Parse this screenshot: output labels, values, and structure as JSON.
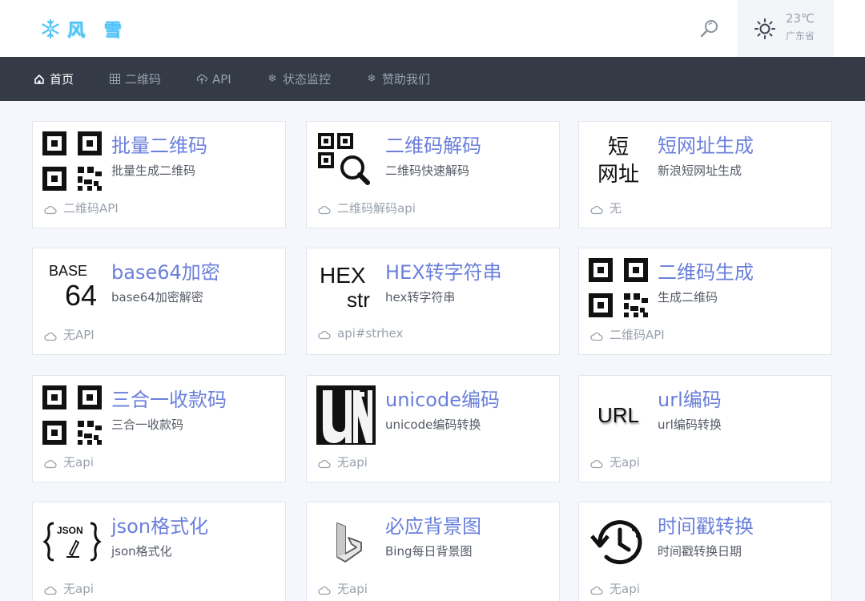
{
  "header": {
    "logo_text": "风 雪",
    "weather": {
      "temp": "23℃",
      "city": "广东省"
    }
  },
  "nav": {
    "items": [
      {
        "label": "首页",
        "icon": "home-icon"
      },
      {
        "label": "二维码",
        "icon": "grid-icon"
      },
      {
        "label": "API",
        "icon": "cloud-upload-icon"
      },
      {
        "label": "状态监控",
        "icon": "snowflake-icon"
      },
      {
        "label": "赞助我们",
        "icon": "snowflake-icon"
      }
    ]
  },
  "cards": [
    {
      "title": "批量二维码",
      "desc": "批量生成二维码",
      "foot": "二维码API",
      "thumb": "qr-code-icon"
    },
    {
      "title": "二维码解码",
      "desc": "二维码快速解码",
      "foot": "二维码解码api",
      "thumb": "qr-search-icon"
    },
    {
      "title": "短网址生成",
      "desc": "新浪短网址生成",
      "foot": "无",
      "thumb": "short-url-text",
      "thumb_text": [
        "短",
        "网址"
      ]
    },
    {
      "title": "base64加密",
      "desc": "base64加密解密",
      "foot": "无API",
      "thumb": "base64-text",
      "thumb_text": [
        "BASE",
        "64"
      ]
    },
    {
      "title": "HEX转字符串",
      "desc": "hex转字符串",
      "foot": "api#strhex",
      "thumb": "hex-text",
      "thumb_text": [
        "HEX",
        "str"
      ]
    },
    {
      "title": "二维码生成",
      "desc": "生成二维码",
      "foot": "二维码API",
      "thumb": "qr-code-icon"
    },
    {
      "title": "三合一收款码",
      "desc": "三合一收款码",
      "foot": "无api",
      "thumb": "qr-code-icon"
    },
    {
      "title": "unicode编码",
      "desc": "unicode编码转换",
      "foot": "无api",
      "thumb": "unicode-logo-icon"
    },
    {
      "title": "url编码",
      "desc": "url编码转换",
      "foot": "无api",
      "thumb": "url-text",
      "thumb_text": [
        "URL"
      ]
    },
    {
      "title": "json格式化",
      "desc": "json格式化",
      "foot": "无api",
      "thumb": "json-icon",
      "thumb_text": [
        "JSON"
      ]
    },
    {
      "title": "必应背景图",
      "desc": "Bing每日背景图",
      "foot": "无api",
      "thumb": "bing-logo-icon"
    },
    {
      "title": "时间戳转换",
      "desc": "时间戳转换日期",
      "foot": "无api",
      "thumb": "clock-history-icon"
    }
  ]
}
